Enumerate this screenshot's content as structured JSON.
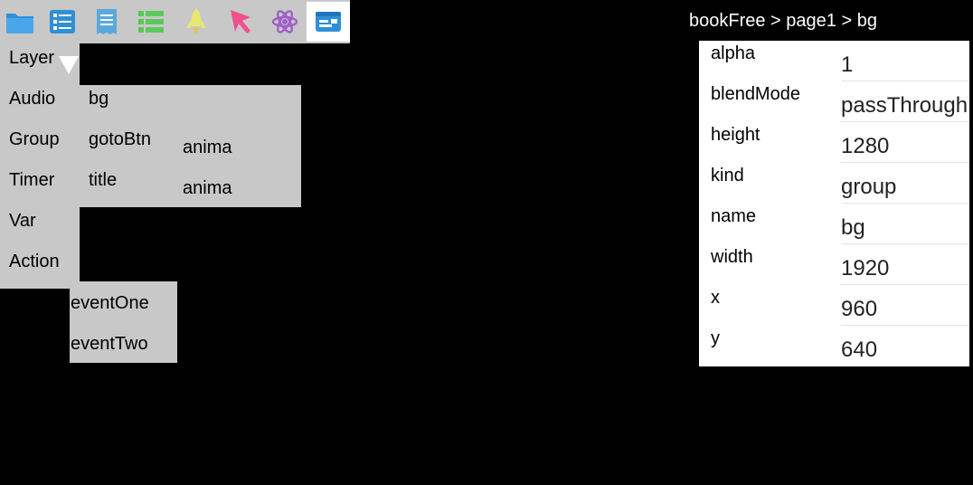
{
  "toolbar": {
    "tools": [
      {
        "icon": "folder-icon",
        "color": "#2f8fd8"
      },
      {
        "icon": "list-icon",
        "color": "#2f8fd8"
      },
      {
        "icon": "receipt-icon",
        "color": "#5aa8e0"
      },
      {
        "icon": "green-list-icon",
        "color": "#5cc85c"
      },
      {
        "icon": "rocket-icon",
        "color": "#e8e870"
      },
      {
        "icon": "cursor-arrow-icon",
        "color": "#f0508c"
      },
      {
        "icon": "atom-icon",
        "color": "#a060c8"
      },
      {
        "icon": "window-panel-icon",
        "color": "#2f8fd8",
        "active": true
      }
    ]
  },
  "menu": {
    "layer": "Layer",
    "audio": "Audio",
    "group": "Group",
    "timer": "Timer",
    "var": "Var",
    "action": "Action"
  },
  "layers": {
    "bg": "bg",
    "gotoBtn": "gotoBtn",
    "title": "title",
    "anima1": "anima",
    "anima2": "anima"
  },
  "events": {
    "one": "eventOne",
    "two": "eventTwo"
  },
  "breadcrumb": "bookFree > page1 > bg",
  "properties": [
    {
      "key": "alpha",
      "value": "1"
    },
    {
      "key": "blendMode",
      "value": "passThrough"
    },
    {
      "key": "height",
      "value": "1280"
    },
    {
      "key": "kind",
      "value": "group"
    },
    {
      "key": "name",
      "value": "bg"
    },
    {
      "key": "width",
      "value": "1920"
    },
    {
      "key": "x",
      "value": "960"
    },
    {
      "key": "y",
      "value": "640"
    }
  ]
}
